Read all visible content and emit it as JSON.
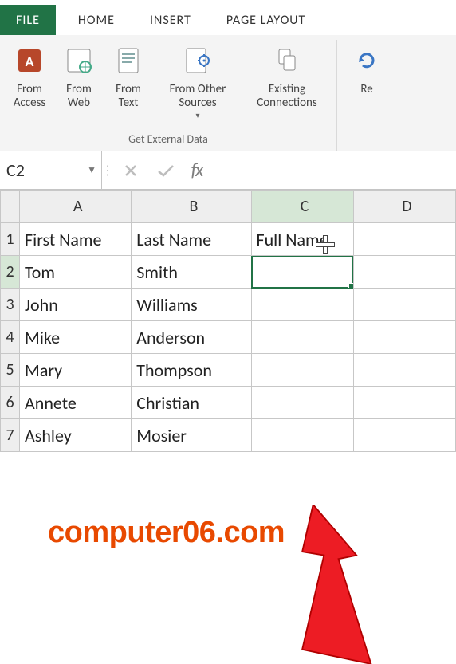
{
  "tabs": {
    "file": "FILE",
    "home": "HOME",
    "insert": "INSERT",
    "page_layout": "PAGE LAYOUT"
  },
  "ribbon": {
    "group_label": "Get External Data",
    "from_access": "From Access",
    "from_web": "From Web",
    "from_text": "From Text",
    "from_other": "From Other Sources",
    "existing_conn": "Existing Connections",
    "refresh_partial": "Re"
  },
  "formula_bar": {
    "name_box": "C2",
    "fx_label": "fx",
    "formula": ""
  },
  "grid": {
    "columns": [
      "A",
      "B",
      "C",
      "D"
    ],
    "rows": [
      {
        "n": "1",
        "a": "First Name",
        "b": "Last Name",
        "c": "Full Name",
        "d": ""
      },
      {
        "n": "2",
        "a": "Tom",
        "b": "Smith",
        "c": "",
        "d": ""
      },
      {
        "n": "3",
        "a": "John",
        "b": "Williams",
        "c": "",
        "d": ""
      },
      {
        "n": "4",
        "a": "Mike",
        "b": "Anderson",
        "c": "",
        "d": ""
      },
      {
        "n": "5",
        "a": "Mary",
        "b": "Thompson",
        "c": "",
        "d": ""
      },
      {
        "n": "6",
        "a": "Annete",
        "b": "Christian",
        "c": "",
        "d": ""
      },
      {
        "n": "7",
        "a": "Ashley",
        "b": "Mosier",
        "c": "",
        "d": ""
      }
    ],
    "selected_cell": "C2"
  },
  "watermark": "computer06.com",
  "colors": {
    "excel_green": "#217346",
    "arrow_red": "#ed1c24",
    "watermark_orange": "#e84900"
  }
}
